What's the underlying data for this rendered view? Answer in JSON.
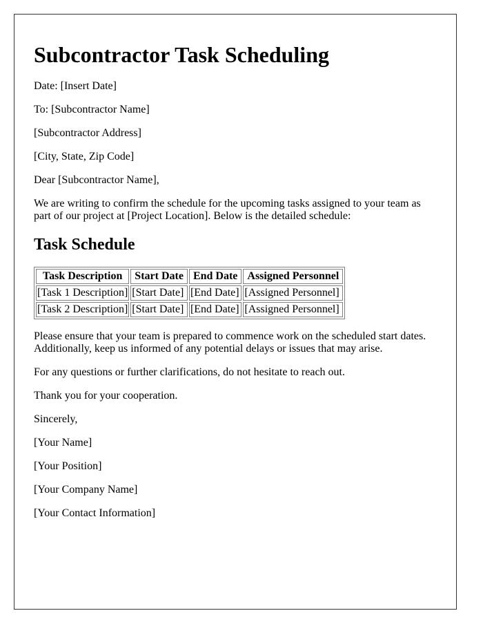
{
  "letter": {
    "title": "Subcontractor Task Scheduling",
    "date_line": "Date: [Insert Date]",
    "to_line": "To: [Subcontractor Name]",
    "address": "[Subcontractor Address]",
    "city_line": "[City, State, Zip Code]",
    "salutation": "Dear [Subcontractor Name],",
    "intro": "We are writing to confirm the schedule for the upcoming tasks assigned to your team as part of our project at [Project Location]. Below is the detailed schedule:",
    "section_heading": "Task Schedule",
    "table": {
      "headers": [
        "Task Description",
        "Start Date",
        "End Date",
        "Assigned Personnel"
      ],
      "rows": [
        [
          "[Task 1 Description]",
          "[Start Date]",
          "[End Date]",
          "[Assigned Personnel]"
        ],
        [
          "[Task 2 Description]",
          "[Start Date]",
          "[End Date]",
          "[Assigned Personnel]"
        ]
      ]
    },
    "ensure_paragraph": "Please ensure that your team is prepared to commence work on the scheduled start dates. Additionally, keep us informed of any potential delays or issues that may arise.",
    "questions_paragraph": "For any questions or further clarifications, do not hesitate to reach out.",
    "thanks": "Thank you for your cooperation.",
    "closing": "Sincerely,",
    "signature": {
      "name": "[Your Name]",
      "position": "[Your Position]",
      "company": "[Your Company Name]",
      "contact": "[Your Contact Information]"
    }
  }
}
